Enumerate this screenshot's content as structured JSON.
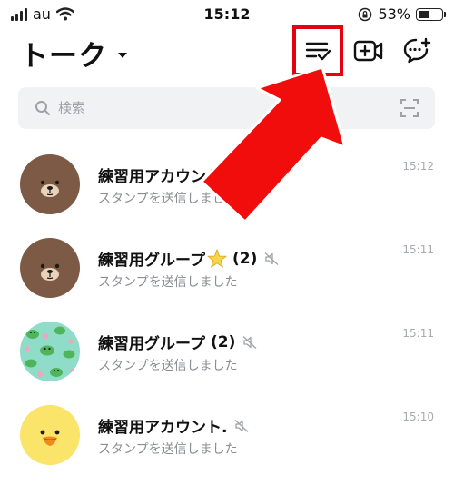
{
  "status_bar": {
    "carrier": "au",
    "time": "15:12",
    "battery_percent": "53%",
    "battery_level": 0.53
  },
  "header": {
    "title": "トーク"
  },
  "search": {
    "placeholder": "検索"
  },
  "chats": [
    {
      "name": "練習用アカウント.",
      "count": "",
      "preview": "スタンプを送信しました",
      "time": "15:12",
      "muted": false,
      "avatar": "brown-bear"
    },
    {
      "name": "練習用グループ",
      "count": "(2)",
      "preview": "スタンプを送信しました",
      "time": "15:11",
      "muted": true,
      "avatar": "brown-bear",
      "emoji": "star"
    },
    {
      "name": "練習用グループ",
      "count": "(2)",
      "preview": "スタンプを送信しました",
      "time": "15:11",
      "muted": true,
      "avatar": "frog-pattern"
    },
    {
      "name": "練習用アカウント.",
      "count": "",
      "preview": "スタンプを送信しました",
      "time": "15:10",
      "muted": true,
      "avatar": "chick"
    }
  ],
  "colors": {
    "highlight": "#e60012",
    "arrow": "#f20d0d",
    "search_bg": "#f1f2f4",
    "preview_text": "#8a8e94",
    "time_text": "#a7abb0"
  },
  "icons": [
    "wifi-icon",
    "signal-icon",
    "rotation-lock-icon",
    "battery-icon",
    "chevron-down-icon",
    "edit-list-icon",
    "video-call-icon",
    "add-chat-icon",
    "search-icon",
    "scan-icon",
    "mute-icon",
    "star-icon"
  ]
}
